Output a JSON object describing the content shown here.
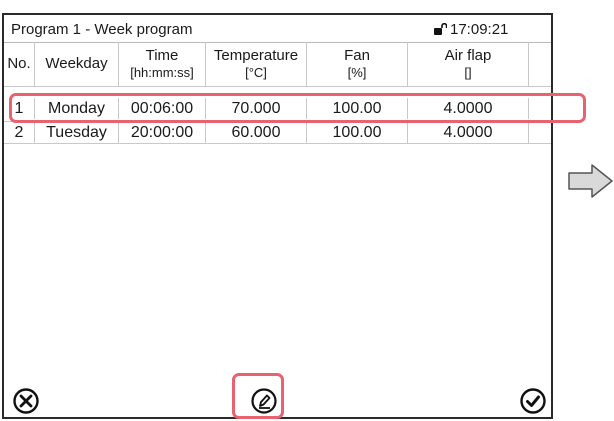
{
  "header": {
    "title": "Program 1 - Week program",
    "time": "17:09:21",
    "lock_icon": "lock-icon"
  },
  "table": {
    "columns": [
      {
        "label": "No.",
        "unit": ""
      },
      {
        "label": "Weekday",
        "unit": ""
      },
      {
        "label": "Time",
        "unit": "[hh:mm:ss]"
      },
      {
        "label": "Temperature",
        "unit": "[°C]"
      },
      {
        "label": "Fan",
        "unit": "[%]"
      },
      {
        "label": "Air flap",
        "unit": "[]"
      }
    ],
    "rows": [
      {
        "no": "1",
        "weekday": "Monday",
        "time": "00:06:00",
        "temperature": "70.000",
        "fan": "100.00",
        "air_flap": "4.0000"
      },
      {
        "no": "2",
        "weekday": "Tuesday",
        "time": "20:00:00",
        "temperature": "60.000",
        "fan": "100.00",
        "air_flap": "4.0000"
      }
    ],
    "selected_row": 0
  },
  "footer": {
    "cancel_icon": "close-circle-icon",
    "edit_icon": "edit-icon",
    "confirm_icon": "checkmark-circle-icon"
  },
  "colors": {
    "highlight": "#e8626f",
    "arrow_fill": "#d9d9d9"
  }
}
